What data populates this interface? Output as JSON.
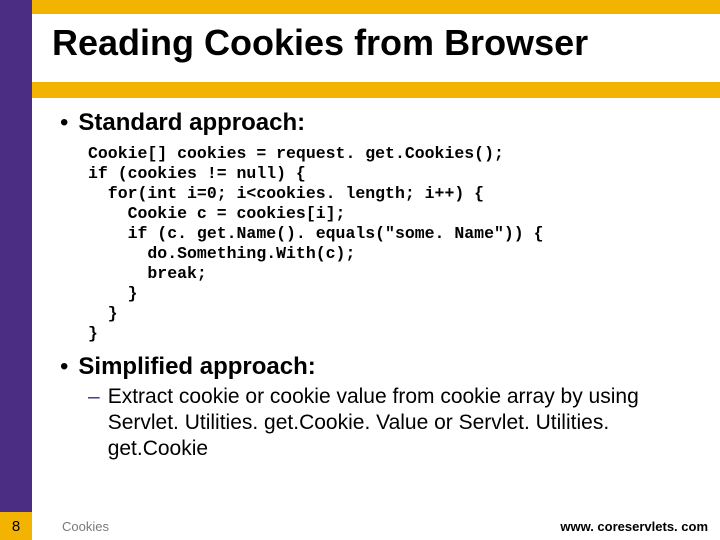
{
  "title": "Reading Cookies from Browser",
  "bullets": {
    "b1": "Standard approach:",
    "b2": "Simplified approach:"
  },
  "code": "Cookie[] cookies = request. get.Cookies();\nif (cookies != null) {\n  for(int i=0; i<cookies. length; i++) {\n    Cookie c = cookies[i];\n    if (c. get.Name(). equals(\"some. Name\")) {\n      do.Something.With(c);\n      break;\n    }\n  }\n}",
  "dash": {
    "mark": "–",
    "text": "Extract cookie or cookie value from cookie array by using Servlet. Utilities. get.Cookie. Value or Servlet. Utilities. get.Cookie"
  },
  "footer": {
    "left": "Cookies",
    "right": "www. coreservlets. com",
    "page": "8"
  }
}
